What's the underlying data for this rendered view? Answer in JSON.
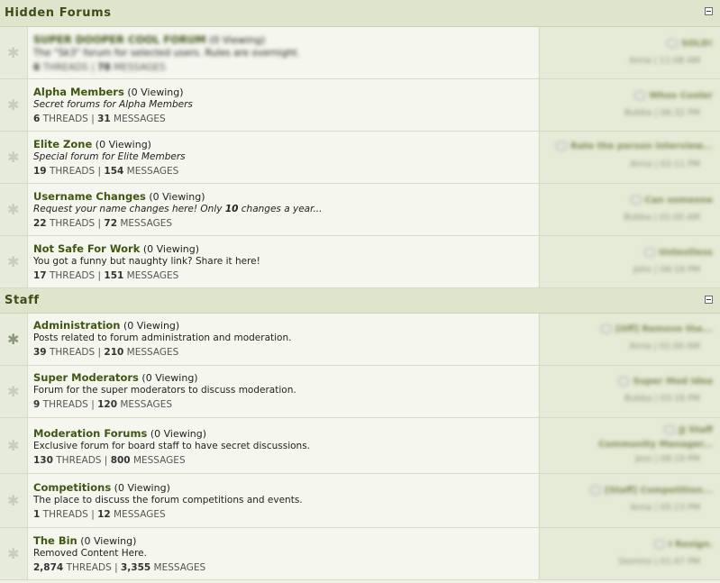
{
  "sections": [
    {
      "title": "Hidden Forums",
      "forums": [
        {
          "name": "SUPER DOOPER COOL FORUM",
          "viewing": "(0 Viewing)",
          "desc": "The \"Sk3\" forum for selected users. Rules are overnight.",
          "threads": "6",
          "messages": "78",
          "lp_title": "SOLD!",
          "lp_meta": "Anna | 11:08 AM",
          "blurred": true,
          "italic": false
        },
        {
          "name": "Alpha Members",
          "viewing": "(0 Viewing)",
          "desc": "Secret forums for Alpha Members",
          "threads": "6",
          "messages": "31",
          "lp_title": "Whos Cooler",
          "lp_meta": "Bubba | 06:32 PM",
          "blurred": false,
          "italic": true
        },
        {
          "name": "Elite Zone",
          "viewing": "(0 Viewing)",
          "desc": "Special forum for Elite Members",
          "threads": "19",
          "messages": "154",
          "lp_title": "Rate the person interview...",
          "lp_meta": "Anna | 02:11 PM",
          "blurred": false,
          "italic": true
        },
        {
          "name": "Username Changes",
          "viewing": "(0 Viewing)",
          "desc_pre": "Request your name changes here! Only ",
          "desc_bold": "10",
          "desc_post": " changes a year...",
          "threads": "22",
          "messages": "72",
          "lp_title": "Can someone",
          "lp_meta": "Bubba | 01:00 AM",
          "blurred": false,
          "italic": true
        },
        {
          "name": "Not Safe For Work",
          "viewing": "(0 Viewing)",
          "desc": "You got a funny but naughty link? Share it here!",
          "threads": "17",
          "messages": "151",
          "lp_title": "Untextless",
          "lp_meta": "John | 06:19 PM",
          "blurred": false,
          "italic": false
        }
      ]
    },
    {
      "title": "Staff",
      "forums": [
        {
          "name": "Administration",
          "viewing": "(0 Viewing)",
          "desc": "Posts related to forum administration and moderation.",
          "threads": "39",
          "messages": "210",
          "lp_title": "[Off] Remove the...",
          "lp_meta": "Anna | 01:00 AM",
          "blurred": false,
          "italic": false,
          "active": true
        },
        {
          "name": "Super Moderators",
          "viewing": "(0 Viewing)",
          "desc": "Forum for the super moderators to discuss moderation.",
          "threads": "9",
          "messages": "120",
          "lp_title": "Super Mod Idea",
          "lp_meta": "Bubba | 03:18 PM",
          "blurred": false,
          "italic": false
        },
        {
          "name": "Moderation Forums",
          "viewing": "(0 Viewing)",
          "desc": "Exclusive forum for board staff to have secret discussions.",
          "threads": "130",
          "messages": "800",
          "lp_title": "JJ Staff",
          "lp_title2": "Community Manager...",
          "lp_meta": "Jess | 08:19 PM",
          "blurred": false,
          "italic": false
        },
        {
          "name": "Competitions",
          "viewing": "(0 Viewing)",
          "desc": "The place to discuss the forum competitions and events.",
          "threads": "1",
          "messages": "12",
          "lp_title": "[Staff] Competition...",
          "lp_meta": "Anna | 05:13 PM",
          "blurred": false,
          "italic": false
        },
        {
          "name": "The Bin",
          "viewing": "(0 Viewing)",
          "desc": "Removed Content Here.",
          "threads": "2,874",
          "messages": "3,355",
          "lp_title": "I Resign.",
          "lp_meta": "Domino | 01:47 PM",
          "blurred": false,
          "italic": false
        }
      ]
    }
  ],
  "labels": {
    "threads": "THREADS",
    "messages": "MESSAGES",
    "sep": "|"
  },
  "icons": {
    "status": "forum-status-icon",
    "collapse": "collapse-icon"
  },
  "colors": {
    "accent": "#3f5514",
    "header_bg": "#dfe5cd",
    "row_bg": "#f5f7ef"
  }
}
